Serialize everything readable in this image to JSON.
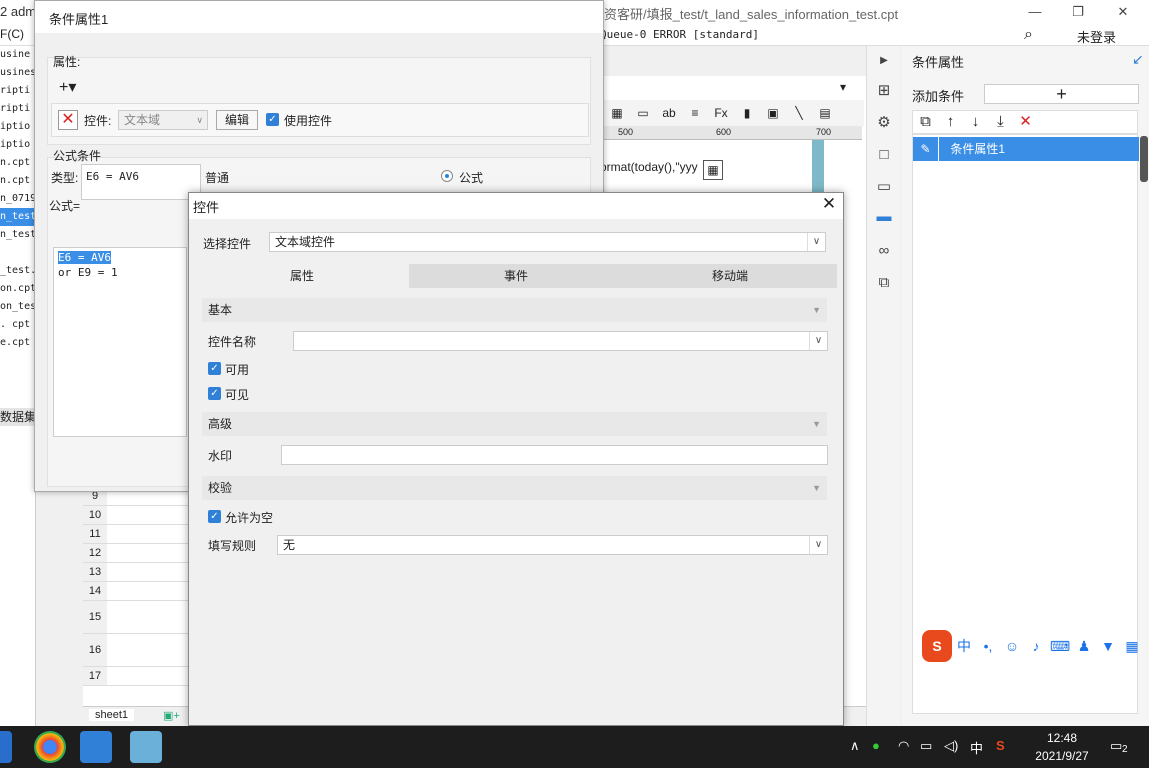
{
  "titlebar": {
    "left_fragment": "2 adm",
    "path": "资客研/填报_test/t_land_sales_information_test.cpt",
    "minimize": "—",
    "restore": "❐",
    "close": "✕"
  },
  "menubar": {
    "left_fragment": "F(C)",
    "log": "Queue-0 ERROR [standard]",
    "login": "未登录"
  },
  "leftlist": [
    "usine",
    "usines",
    "ripti",
    "ripti",
    "iptio",
    "iptio",
    "n.cpt",
    "n.cpt",
    "n_0719",
    "n_test",
    "n_test",
    "",
    "_test.",
    "on.cpt",
    "on_tes",
    ". cpt",
    "e.cpt",
    "",
    "",
    "数据集"
  ],
  "sheet": {
    "rows": [
      "9",
      "10",
      "11",
      "12",
      "13",
      "14",
      "15",
      "16",
      "17"
    ],
    "formula_text": "ormat(today(),\"yyy",
    "tab": "sheet1",
    "ruler": [
      "500",
      "600",
      "700"
    ]
  },
  "dlg_condition": {
    "title": "条件属性1",
    "attr_label": "属性:",
    "add_label": "+▾",
    "control_label": "控件:",
    "control_value": "文本域",
    "edit_button": "编辑",
    "use_control": "使用控件",
    "formula_condition": "公式条件",
    "type_label": "类型:",
    "radio_normal": "普通",
    "radio_formula": "公式",
    "formula_label": "公式=",
    "formula_value": "E6 = AV6",
    "preview_line1": "E6 = AV6",
    "preview_line2": "or  E9 = 1"
  },
  "dlg_control": {
    "title": "控件",
    "close": "✕",
    "select_label": "选择控件",
    "select_value": "文本域控件",
    "tabs": [
      "属性",
      "事件",
      "移动端"
    ],
    "section_basic": "基本",
    "name_label": "控件名称",
    "name_value": "",
    "enabled": "可用",
    "visible": "可见",
    "section_advanced": "高级",
    "watermark_label": "水印",
    "watermark_value": "",
    "section_validate": "校验",
    "allow_empty": "允许为空",
    "rule_label": "填写规则",
    "rule_value": "无"
  },
  "rpanel": {
    "title": "条件属性",
    "add_condition": "添加条件",
    "add_symbol": "+",
    "item": "条件属性1"
  },
  "taskbar": {
    "time": "12:48",
    "date": "2021/9/27",
    "ime": "中",
    "notif": "2"
  },
  "colors": {
    "accent": "#3a8ee6",
    "checkbox": "#2f80d6",
    "taskbar": "#1d1d1d"
  }
}
